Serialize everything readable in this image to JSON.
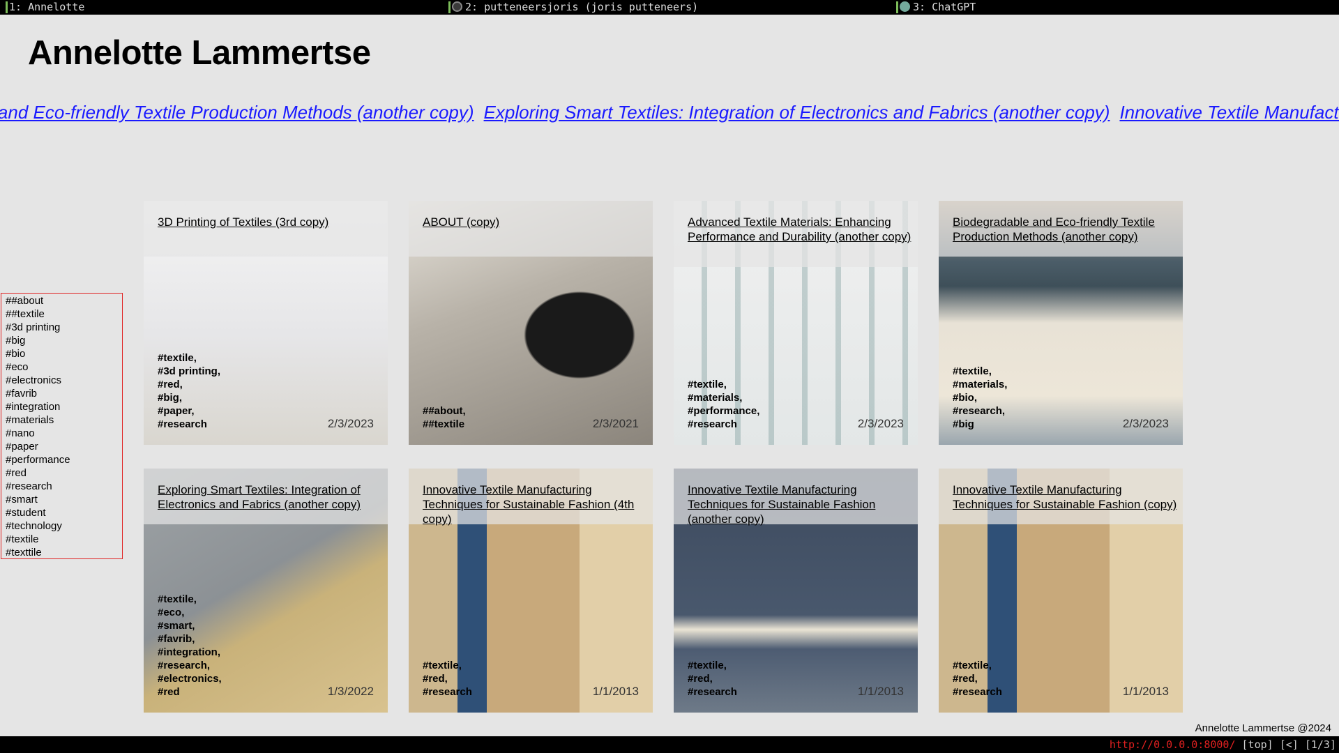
{
  "tabs": [
    {
      "label": "1: Annelotte",
      "favicon": ""
    },
    {
      "label": "2: putteneersjoris (joris putteneers)",
      "favicon": "github-icon"
    },
    {
      "label": "3: ChatGPT",
      "favicon": "chatgpt-icon"
    }
  ],
  "site": {
    "title": "Annelotte Lammertse"
  },
  "marquee": [
    "Biodegradable and Eco-friendly Textile Production Methods (another copy)",
    "Exploring Smart Textiles: Integration of Electronics and Fabrics (another copy)",
    "Innovative Textile Manufacturing Techniques for Sustainable Fashion"
  ],
  "tags": [
    "##about",
    "##textile",
    "#3d printing",
    "#big",
    "#bio",
    "#eco",
    "#electronics",
    "#favrib",
    "#integration",
    "#materials",
    "#nano",
    "#paper",
    "#performance",
    "#red",
    "#research",
    "#smart",
    "#student",
    "#technology",
    "#textile",
    "#texttile"
  ],
  "cards": [
    {
      "title": "3D Printing of Textiles (3rd copy)",
      "tags": [
        "#textile,",
        "#3d printing,",
        "#red,",
        "#big,",
        "#paper,",
        "#research"
      ],
      "date": "2/3/2023"
    },
    {
      "title": "ABOUT (copy)",
      "tags": [
        "##about,",
        "##textile"
      ],
      "date": "2/3/2021"
    },
    {
      "title": "Advanced Textile Materials: Enhancing Performance and Durability (another copy)",
      "tags": [
        "#textile,",
        "#materials,",
        "#performance,",
        "#research"
      ],
      "date": "2/3/2023"
    },
    {
      "title": "Biodegradable and Eco-friendly Textile Production Methods (another copy)",
      "tags": [
        "#textile,",
        "#materials,",
        "#bio,",
        "#research,",
        "#big"
      ],
      "date": "2/3/2023"
    },
    {
      "title": "Exploring Smart Textiles: Integration of Electronics and Fabrics (another copy)",
      "tags": [
        "#textile,",
        "#eco,",
        "#smart,",
        "#favrib,",
        "#integration,",
        "#research,",
        "#electronics,",
        "#red"
      ],
      "date": "1/3/2022"
    },
    {
      "title": "Innovative Textile Manufacturing Techniques for Sustainable Fashion (4th copy)",
      "tags": [
        "#textile,",
        "#red,",
        "#research"
      ],
      "date": "1/1/2013"
    },
    {
      "title": "Innovative Textile Manufacturing Techniques for Sustainable Fashion (another copy)",
      "tags": [
        "#textile,",
        "#red,",
        "#research"
      ],
      "date": "1/1/2013"
    },
    {
      "title": "Innovative Textile Manufacturing Techniques for Sustainable Fashion (copy)",
      "tags": [
        "#textile,",
        "#red,",
        "#research"
      ],
      "date": "1/1/2013"
    }
  ],
  "footer": {
    "credit": "Annelotte Lammertse @2024"
  },
  "status": {
    "url": "http://0.0.0.0:8000/",
    "position": "[top]",
    "history": "[<]",
    "tab_index": "[1/3]"
  },
  "colors": {
    "link": "#1a1aff",
    "tag_border": "#e02020",
    "background": "#e5e5e5"
  }
}
